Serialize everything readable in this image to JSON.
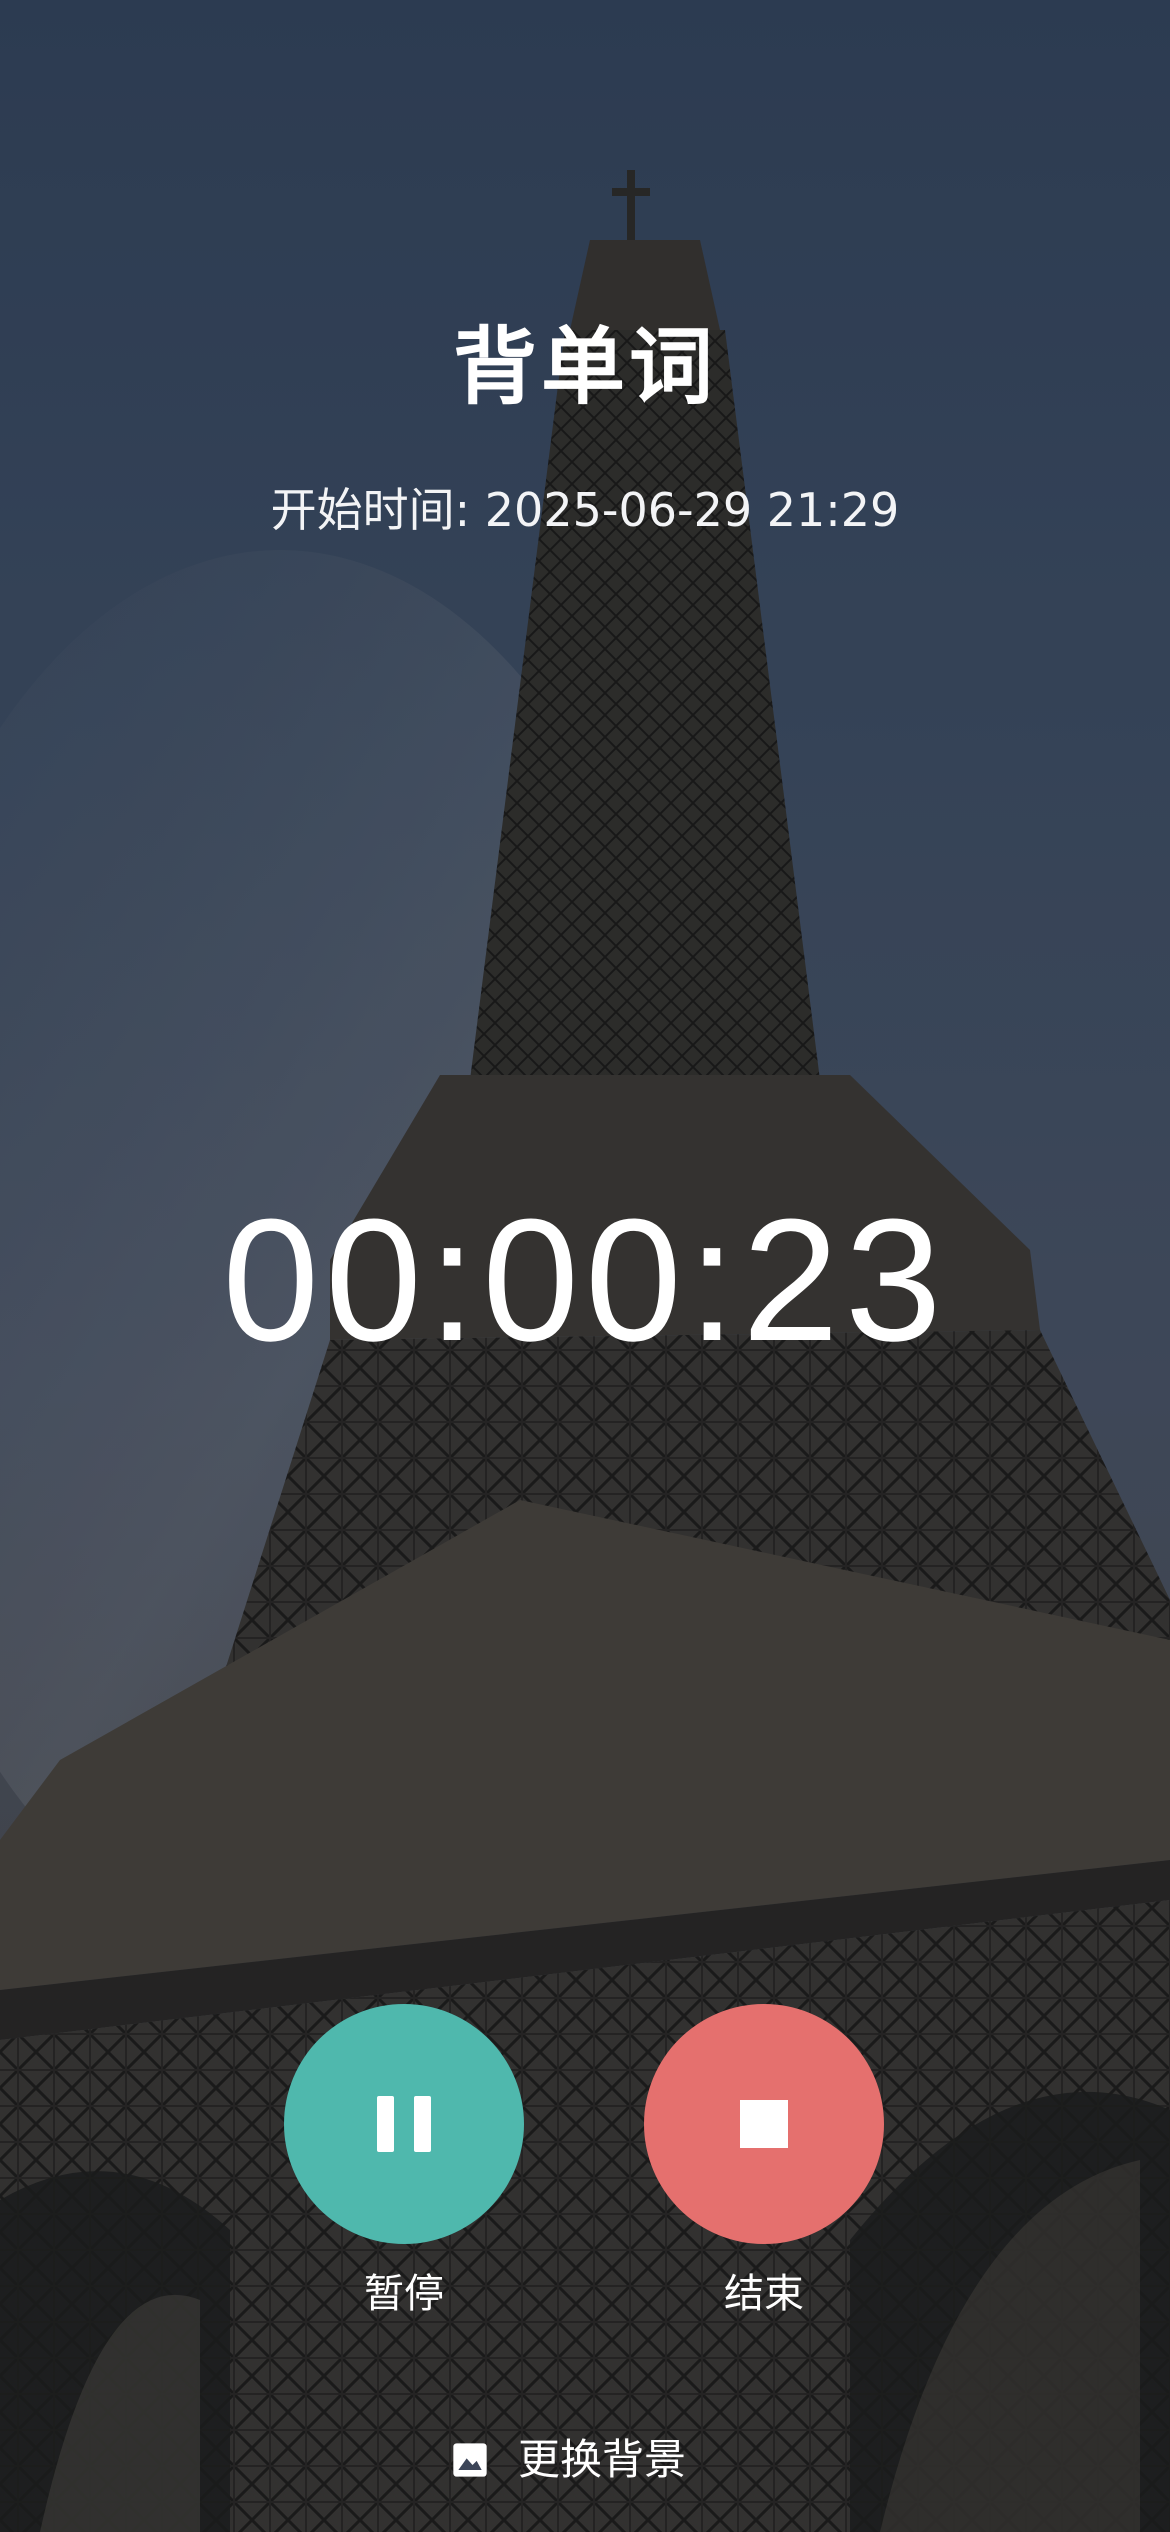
{
  "screen": {
    "title": "背单词",
    "start_time": "开始时间: 2025-06-29 21:29",
    "timer": "00:00:23"
  },
  "controls": {
    "pause": {
      "label": "暂停",
      "icon": "pause-icon",
      "color": "#4fb8ad"
    },
    "stop": {
      "label": "结束",
      "icon": "stop-icon",
      "color": "#e5706e"
    }
  },
  "footer": {
    "change_background_label": "更换背景",
    "icon": "image-icon"
  },
  "background": {
    "subject": "eiffel-tower-photo",
    "sky_color": "#3a4a63",
    "structure_color": "#2a2826"
  }
}
